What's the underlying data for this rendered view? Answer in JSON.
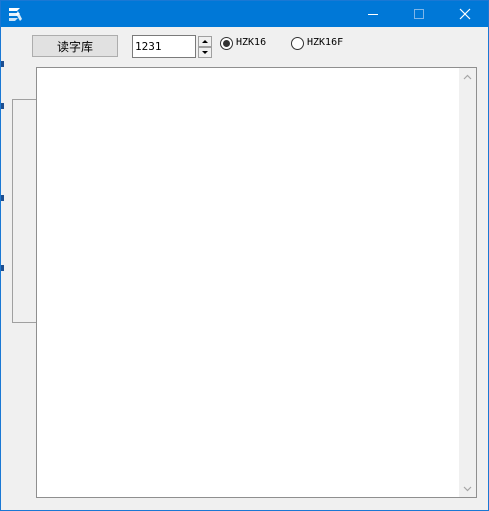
{
  "window": {
    "title": "",
    "app_icon": "app-logo-icon",
    "title_color": "#0078d7",
    "controls": [
      "minimize-icon",
      "maximize-icon",
      "close-icon"
    ]
  },
  "toolbar": {
    "read_button_label": "读字库",
    "number_value": "1231",
    "spin_icons": [
      "spin-up-icon",
      "spin-down-icon"
    ],
    "radio_options": [
      {
        "label": "HZK16",
        "selected": true
      },
      {
        "label": "HZK16F",
        "selected": false
      }
    ]
  },
  "main": {
    "textarea_value": "",
    "scroll_icons": [
      "scroll-up-icon",
      "scroll-down-icon"
    ]
  }
}
